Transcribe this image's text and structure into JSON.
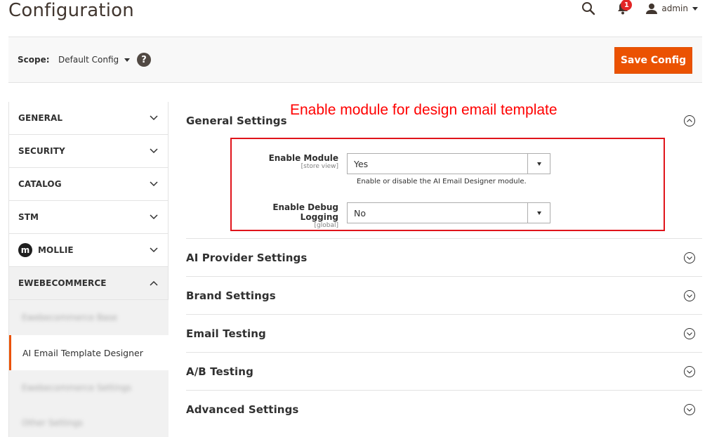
{
  "header": {
    "title": "Configuration",
    "notifications_count": "1",
    "user_name": "admin"
  },
  "scope_bar": {
    "label": "Scope:",
    "selected": "Default Config",
    "help": "?",
    "save_label": "Save Config"
  },
  "sidebar": {
    "items": [
      {
        "label": "GENERAL"
      },
      {
        "label": "SECURITY"
      },
      {
        "label": "CATALOG"
      },
      {
        "label": "STM"
      },
      {
        "label": "MOLLIE",
        "logo": "m"
      },
      {
        "label": "EWEBECOMMERCE"
      }
    ],
    "subitems": [
      {
        "label": "Ewebecommerce Base"
      },
      {
        "label": "AI Email Template Designer"
      },
      {
        "label": "Ewebecommerce Settings"
      },
      {
        "label": "Other Settings"
      }
    ]
  },
  "annotation": "Enable module for design email template",
  "sections": [
    {
      "title": "General Settings"
    },
    {
      "title": "AI Provider Settings"
    },
    {
      "title": "Brand Settings"
    },
    {
      "title": "Email Testing"
    },
    {
      "title": "A/B Testing"
    },
    {
      "title": "Advanced Settings"
    }
  ],
  "fields": {
    "enable_module": {
      "label": "Enable Module",
      "scope": "[store view]",
      "value": "Yes",
      "note": "Enable or disable the AI Email Designer module."
    },
    "enable_debug": {
      "label": "Enable Debug Logging",
      "scope": "[global]",
      "value": "No"
    }
  },
  "colors": {
    "accent": "#eb5202",
    "annotation": "#ff0000",
    "badge": "#e22626"
  }
}
